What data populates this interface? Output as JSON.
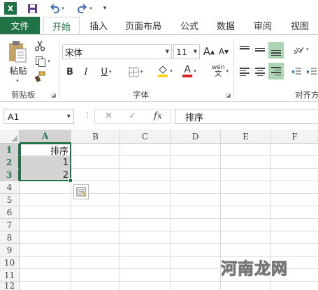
{
  "qat": {
    "app_icon": "X",
    "icons": [
      "excel-logo",
      "save-icon",
      "undo-icon",
      "redo-icon",
      "customize-icon"
    ]
  },
  "tabs": {
    "file": "文件",
    "items": [
      "开始",
      "插入",
      "页面布局",
      "公式",
      "数据",
      "审阅",
      "视图"
    ],
    "active": "开始"
  },
  "ribbon": {
    "clipboard": {
      "paste_label": "粘贴",
      "group_label": "剪贴板"
    },
    "font": {
      "family": "宋体",
      "size": "11",
      "group_label": "字体",
      "bold": "B",
      "italic": "I",
      "underline": "U",
      "grow_label": "A",
      "shrink_label": "A",
      "font_color_label": "A",
      "phonetic_label": "wén",
      "font_color": "#e0201e",
      "fill_color": "#ffd500"
    },
    "alignment": {
      "group_label": "对齐方"
    }
  },
  "formula_bar": {
    "cell_ref": "A1",
    "cancel": "✕",
    "enter": "✓",
    "fx": "fx",
    "content": "排序"
  },
  "grid": {
    "columns": [
      "A",
      "B",
      "C",
      "D",
      "E",
      "F"
    ],
    "selected_column": "A",
    "rows": [
      "1",
      "2",
      "3",
      "4",
      "5",
      "6",
      "7",
      "8",
      "9",
      "10",
      "11",
      "12"
    ],
    "cells": {
      "A1": "排序",
      "A2": "1",
      "A3": "2"
    },
    "selected_range": "A1:A3"
  },
  "watermark": "河南龙网",
  "colors": {
    "accent": "#217346",
    "selection": "#d4d4d4"
  }
}
